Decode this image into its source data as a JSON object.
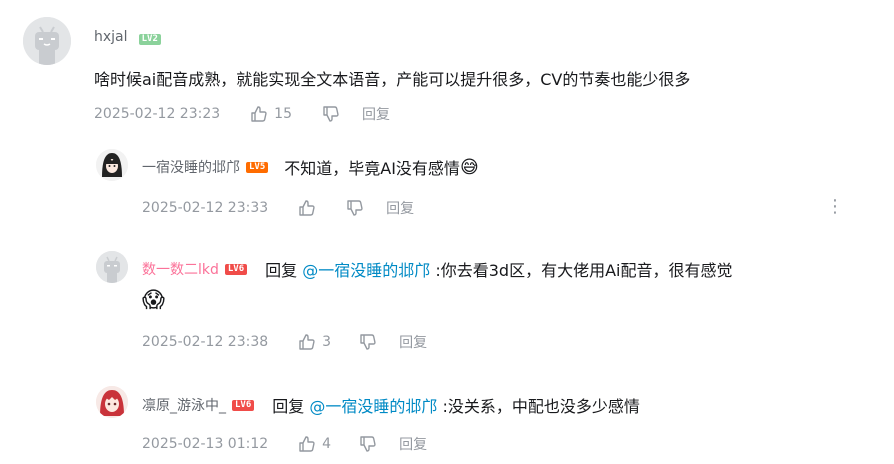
{
  "comment": {
    "user": "hxjal",
    "level": "LV2",
    "text": "啥时候ai配音成熟，就能实现全文本语音，产能可以提升很多，CV的节奏也能少很多",
    "time": "2025-02-12 23:23",
    "likes": "15",
    "reply_label": "回复"
  },
  "replies": [
    {
      "user": "一宿没睡的邶邝",
      "level": "LV5",
      "text": "不知道，毕竟AI没有感情",
      "emoji": "😅",
      "time": "2025-02-12 23:33",
      "likes": "",
      "reply_label": "回复",
      "more": "⋮"
    },
    {
      "user": "数一数二lkd",
      "level": "LV6",
      "prefix": "回复 ",
      "mention": "@一宿没睡的邶邝",
      "text": " :你去看3d区，有大佬用Ai配音，很有感觉",
      "emoji": "😱",
      "time": "2025-02-12 23:38",
      "likes": "3",
      "reply_label": "回复"
    },
    {
      "user": "凛原_游泳中_",
      "level": "LV6",
      "prefix": "回复 ",
      "mention": "@一宿没睡的邶邝",
      "text": " :没关系，中配也没多少感情",
      "time": "2025-02-13 01:12",
      "likes": "4",
      "reply_label": "回复"
    }
  ],
  "icons": {
    "like": "thumbs-up-icon",
    "dislike": "thumbs-down-icon",
    "more": "more-vertical-icon"
  },
  "colors": {
    "mention": "#008ac5",
    "pink_name": "#fb7299",
    "meta": "#9499a0",
    "lv2": "#8bd29b",
    "lv5": "#ff6c00",
    "lv6": "#f04c49"
  }
}
